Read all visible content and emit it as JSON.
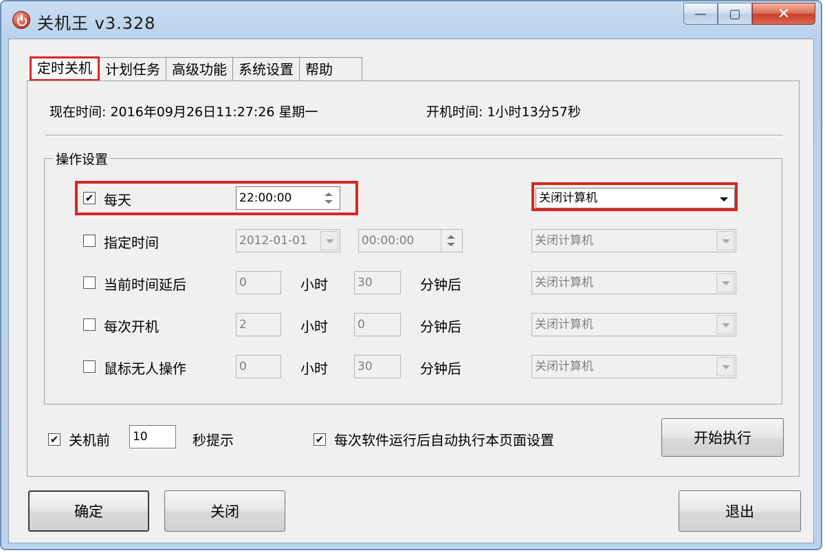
{
  "window": {
    "title": "关机王 v3.328",
    "controls": {
      "minimize": "—",
      "maximize": "▢",
      "close": "✕"
    }
  },
  "tabs": [
    "定时关机",
    "计划任务",
    "高级功能",
    "系统设置",
    "帮助"
  ],
  "info": {
    "now_label": "现在时间: 2016年09月26日11:27:26 星期一",
    "uptime_label": "开机时间: 1小时13分57秒"
  },
  "group": {
    "title": "操作设置",
    "rows": [
      {
        "label": "每天",
        "checked": "☑",
        "time": "22:00:00",
        "action": "关闭计算机"
      },
      {
        "label": "指定时间",
        "date": "2012-01-01",
        "time": "00:00:00",
        "action": "关闭计算机"
      },
      {
        "label": "当前时间延后",
        "hours": "0",
        "hours_unit": "小时",
        "minutes": "30",
        "minutes_unit": "分钟后",
        "action": "关闭计算机"
      },
      {
        "label": "每次开机",
        "hours": "2",
        "hours_unit": "小时",
        "minutes": "0",
        "minutes_unit": "分钟后",
        "action": "关闭计算机"
      },
      {
        "label": "鼠标无人操作",
        "hours": "0",
        "hours_unit": "小时",
        "minutes": "30",
        "minutes_unit": "分钟后",
        "action": "关闭计算机"
      }
    ]
  },
  "options": {
    "before_label": "关机前",
    "before_value": "10",
    "before_suffix": "秒提示",
    "auto_label": "每次软件运行后自动执行本页面设置",
    "check_mark": "✔"
  },
  "buttons": {
    "start": "开始执行",
    "ok": "确定",
    "close": "关闭",
    "exit": "退出"
  },
  "colors": {
    "highlight": "#d72623"
  }
}
